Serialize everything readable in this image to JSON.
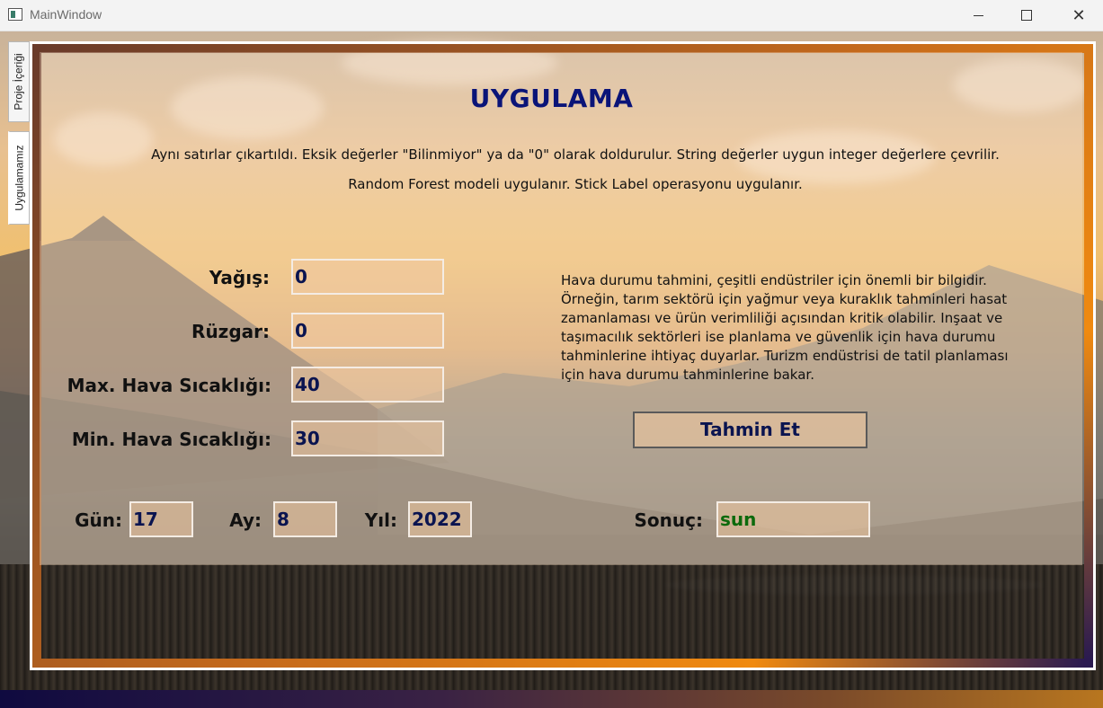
{
  "window": {
    "title": "MainWindow"
  },
  "tabs": [
    {
      "label": "Proje İçeriği"
    },
    {
      "label": "Uygulamamız"
    }
  ],
  "header": {
    "title": "UYGULAMA",
    "description_line1": "Aynı satırlar çıkartıldı. Eksik değerler \"Bilinmiyor\" ya da \"0\" olarak doldurulur. String değerler uygun integer değerlere çevrilir.",
    "description_line2": "Random Forest modeli uygulanır. Stick Label operasyonu uygulanır."
  },
  "form": {
    "yagis": {
      "label": "Yağış:",
      "value": "0"
    },
    "ruzgar": {
      "label": "Rüzgar:",
      "value": "0"
    },
    "max_temp": {
      "label": "Max. Hava Sıcaklığı:",
      "value": "40"
    },
    "min_temp": {
      "label": "Min. Hava Sıcaklığı:",
      "value": "30"
    },
    "gun": {
      "label": "Gün:",
      "value": "17"
    },
    "ay": {
      "label": "Ay:",
      "value": "8"
    },
    "yil": {
      "label": "Yıl:",
      "value": "2022"
    }
  },
  "info_text": "Hava  durumu  tahmini, çeşitli  endüstriler için önemli bir bilgidir.\nÖrneğin, tarım sektörü için yağmur veya kuraklık tahminleri hasat\nzamanlaması ve ürün verimliliği açısından kritik olabilir. Inşaat ve\ntaşımacılık  sektörleri ise  planlama ve güvenlik için  hava durumu\ntahminlerine ihtiyaç duyarlar. Turizm endüstrisi de tatil planlaması\niçin hava durumu tahminlerine bakar.",
  "predict_button": {
    "label": "Tahmin Et"
  },
  "result": {
    "label": "Sonuç:",
    "value": "sun"
  },
  "colors": {
    "title": "#0a1478",
    "field_text": "#0a1450",
    "result_text": "#0c6a0c"
  },
  "icons": {
    "app": "app-window-icon",
    "minimize": "minimize-icon",
    "maximize": "maximize-icon",
    "close": "close-icon"
  }
}
